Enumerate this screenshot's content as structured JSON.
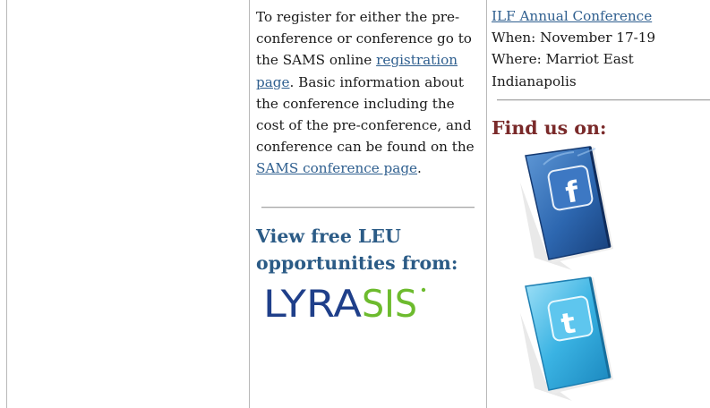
{
  "registration": {
    "text_1": "To register for either the pre-conference or conference go to the SAMS online ",
    "link_1": "registration page",
    "text_2": ".  Basic information about the conference including the cost of the pre-conference, and conference can be found on the ",
    "link_2": "SAMS conference page",
    "text_3": "."
  },
  "leu": {
    "heading": "View free LEU opportunities from:",
    "logo_text": "LYRASIS"
  },
  "conference": {
    "link": "ILF Annual Conference",
    "when": "When: November 17-19",
    "where": "Where: Marriot East Indianapolis"
  },
  "social": {
    "heading": "Find us on:",
    "facebook_letter": "f",
    "twitter_letter": "t"
  },
  "colors": {
    "link": "#2f5f8f",
    "heading_blue": "#2b5b86",
    "heading_red": "#7a2a2a",
    "facebook_blue": "#2d67b0",
    "twitter_blue": "#3ab3e3"
  }
}
